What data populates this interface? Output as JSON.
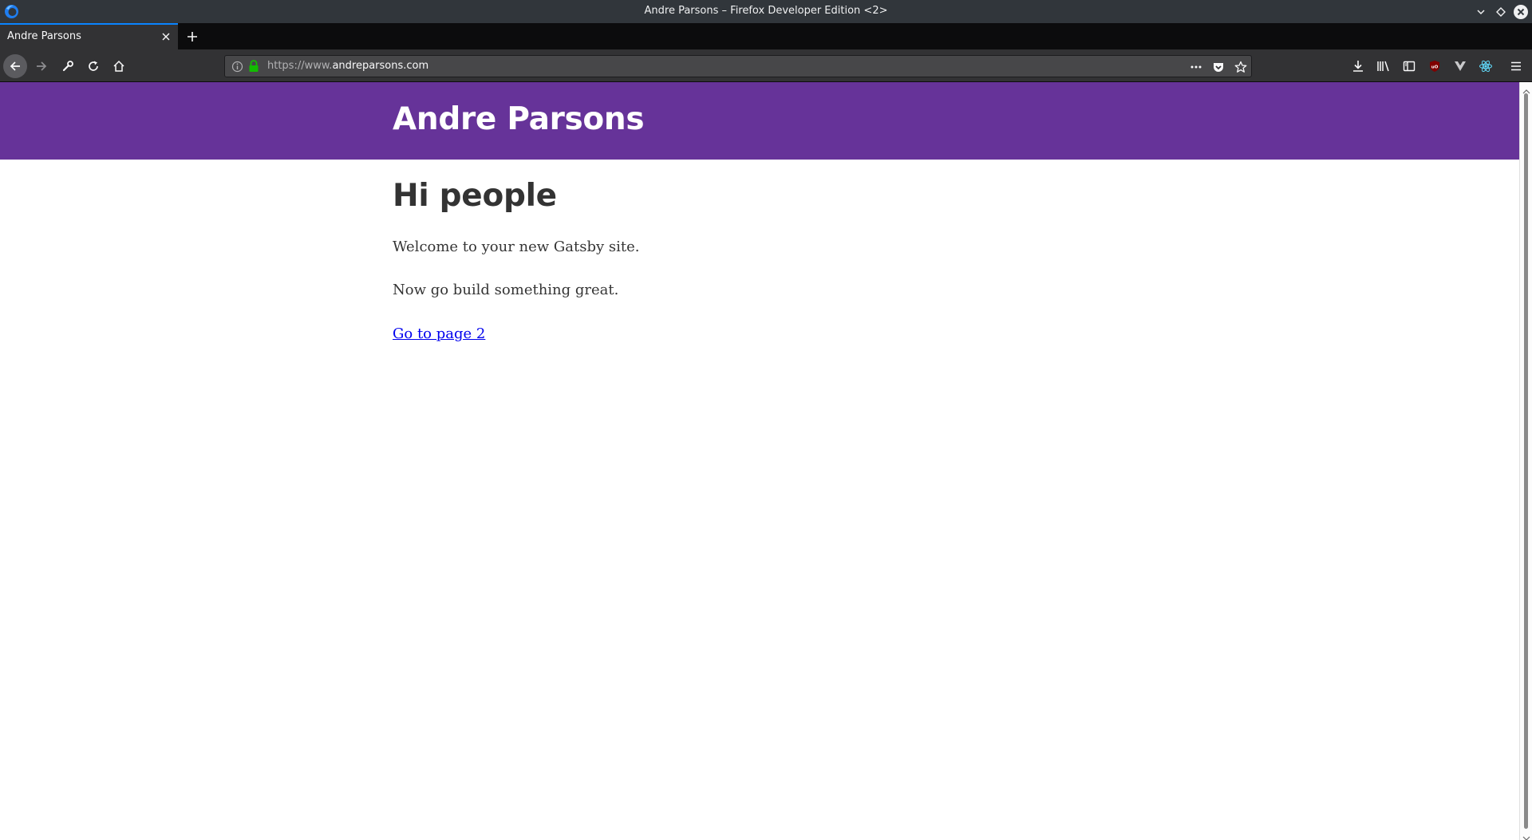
{
  "window": {
    "title": "Andre Parsons – Firefox Developer Edition <2>",
    "app_icon": "firefox-developer-edition-icon",
    "controls": [
      "minimize-icon",
      "maximize-icon",
      "close-icon"
    ]
  },
  "tabs": [
    {
      "label": "Andre Parsons",
      "active": true
    }
  ],
  "toolbar": {
    "buttons": [
      "back-arrow-icon",
      "forward-arrow-icon",
      "wrench-icon",
      "reload-icon",
      "home-icon"
    ],
    "url_scheme": "https://www.",
    "url_host": "andreparsons.com",
    "page_actions": [
      "more-actions-icon",
      "pocket-icon",
      "bookmark-star-icon"
    ],
    "right_icons": [
      "downloads-icon",
      "library-icon",
      "sidebar-icon",
      "ublock-origin-icon",
      "vue-devtools-icon",
      "react-devtools-icon",
      "hamburger-menu-icon"
    ]
  },
  "page": {
    "site_title": "Andre Parsons",
    "heading": "Hi people",
    "paragraphs": [
      "Welcome to your new Gatsby site.",
      "Now go build something great."
    ],
    "link_label": "Go to page 2"
  },
  "colors": {
    "header_bg": "#663399",
    "accent_tab": "#0a84ff",
    "lock_green": "#12bc00",
    "link": "#0000ee"
  }
}
